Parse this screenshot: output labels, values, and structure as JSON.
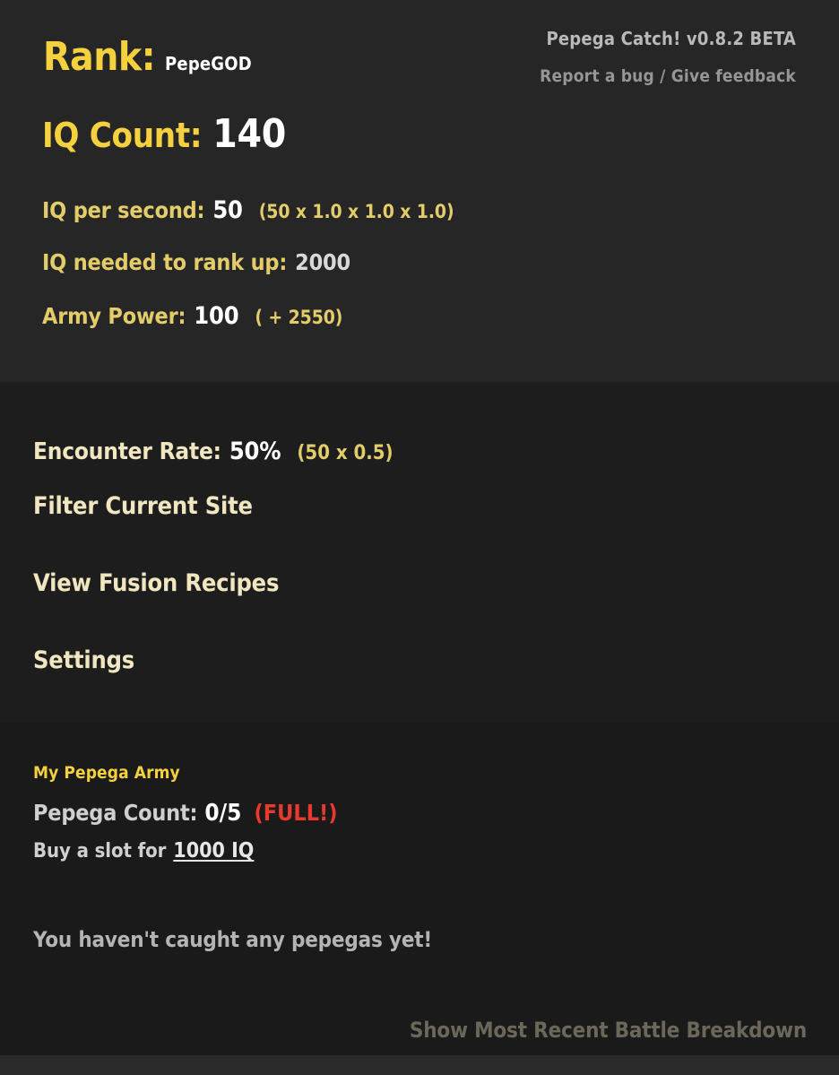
{
  "header": {
    "version_title": "Pepega Catch! v0.8.2 BETA",
    "feedback_link": "Report a bug / Give feedback",
    "rank_label": "Rank:",
    "rank_value": "PepeGOD",
    "iq_count_label": "IQ Count:",
    "iq_count_value": "140"
  },
  "stats": [
    {
      "label": "IQ per second:",
      "value": "50",
      "detail": "(50 x 1.0 x 1.0 x 1.0)"
    },
    {
      "label": "IQ needed to rank up:",
      "value": "2000",
      "detail": ""
    },
    {
      "label": "Army Power:",
      "value": "100",
      "detail": "( + 2550)"
    }
  ],
  "menu": {
    "encounter_label": "Encounter Rate:",
    "encounter_value": "50%",
    "encounter_detail": "(50 x 0.5)",
    "items": [
      {
        "label": "Filter Current Site"
      },
      {
        "label": "View Fusion Recipes"
      },
      {
        "label": "Settings"
      }
    ]
  },
  "army": {
    "title": "My Pepega Army",
    "count_label": "Pepega Count:",
    "count_value": "0/5",
    "full_badge": "(FULL!)",
    "buy_label": "Buy a slot for",
    "buy_price": "1000 IQ",
    "empty_message": "You haven't caught any pepegas yet!",
    "battle_breakdown_link": "Show Most Recent Battle Breakdown"
  },
  "colors": {
    "bright_yellow": "#f5d13f",
    "muted_gold": "#e3cc6a",
    "pale_cream": "#f0e6c0",
    "white": "#ffffff",
    "light_gray": "#d8d8d8",
    "red_alert": "#e8392c",
    "olive_gray": "#6b6759",
    "band_header_bg": "#262626",
    "band_menu_bg": "#1d1d1d",
    "band_army_bg": "#1a1a1a",
    "band_footer_bg": "#2a2a2a"
  }
}
